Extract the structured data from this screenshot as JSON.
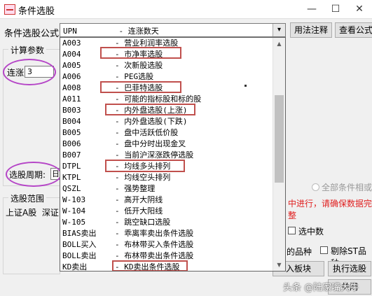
{
  "window": {
    "title": "条件选股",
    "icon": "stock-selector-app-icon",
    "minimize_glyph": "—",
    "maximize_glyph": "☐",
    "close_glyph": "✕"
  },
  "formula": {
    "label": "条件选股公式",
    "selected": "UPN         - 连涨数天",
    "arrow_glyph": "▾"
  },
  "buttons": {
    "usage_notes": "用法注释",
    "view_formula": "查看公式",
    "add_to_block": "入板块",
    "run_selection": "执行选股",
    "close": "关闭"
  },
  "params": {
    "group_title": "计算参数",
    "consecutive_label": "连涨",
    "consecutive_value": "3"
  },
  "period": {
    "label": "选股周期:",
    "value": "日"
  },
  "range": {
    "group_title": "选股范围",
    "markets": "上证A股  深证"
  },
  "right_panel": {
    "all_conditions": "全部条件相或",
    "warning": "中进行，请确保数据完整",
    "in_selection": "选中数",
    "variety": "的品种",
    "exclude_st": "剔除ST品种"
  },
  "dropdown": {
    "items": [
      {
        "code": "A003",
        "desc": "- 营业利润率选股"
      },
      {
        "code": "A004",
        "desc": "- 市净率选股"
      },
      {
        "code": "A005",
        "desc": "- 次新股选股"
      },
      {
        "code": "A006",
        "desc": "- PEG选股"
      },
      {
        "code": "A008",
        "desc": "- 巴菲特选股"
      },
      {
        "code": "A011",
        "desc": "- 可能的指标股和标的股"
      },
      {
        "code": "B003",
        "desc": "- 内外盘选股(上涨)"
      },
      {
        "code": "B004",
        "desc": "- 内外盘选股(下跌)"
      },
      {
        "code": "B005",
        "desc": "- 盘中活跃低价股"
      },
      {
        "code": "B006",
        "desc": "- 盘中分时出现金叉"
      },
      {
        "code": "B007",
        "desc": "- 当前沪深涨跌停选股"
      },
      {
        "code": "DTPL",
        "desc": "- 均线多头排列"
      },
      {
        "code": "KTPL",
        "desc": "- 均线空头排列"
      },
      {
        "code": "QSZL",
        "desc": "- 强势整理"
      },
      {
        "code": "W-103",
        "desc": "- 高开大阴线"
      },
      {
        "code": "W-104",
        "desc": "- 低开大阳线"
      },
      {
        "code": "W-105",
        "desc": "- 跳空缺口选股"
      },
      {
        "code": "BIAS卖出",
        "desc": "- 乖离率卖出条件选股"
      },
      {
        "code": "BOLL买入",
        "desc": "- 布林带买入条件选股"
      },
      {
        "code": "BOLL卖出",
        "desc": "- 布林带卖出条件选股"
      },
      {
        "code": "KD卖出",
        "desc": "- KD卖出条件选股"
      }
    ],
    "scroll_up_glyph": "▲",
    "scroll_down_glyph": "▼"
  },
  "watermark": "头条 @陆家嘴大牛",
  "colors": {
    "highlight_box": "#c0504d",
    "ellipse": "#b545c7",
    "warning_text": "#e02020"
  }
}
